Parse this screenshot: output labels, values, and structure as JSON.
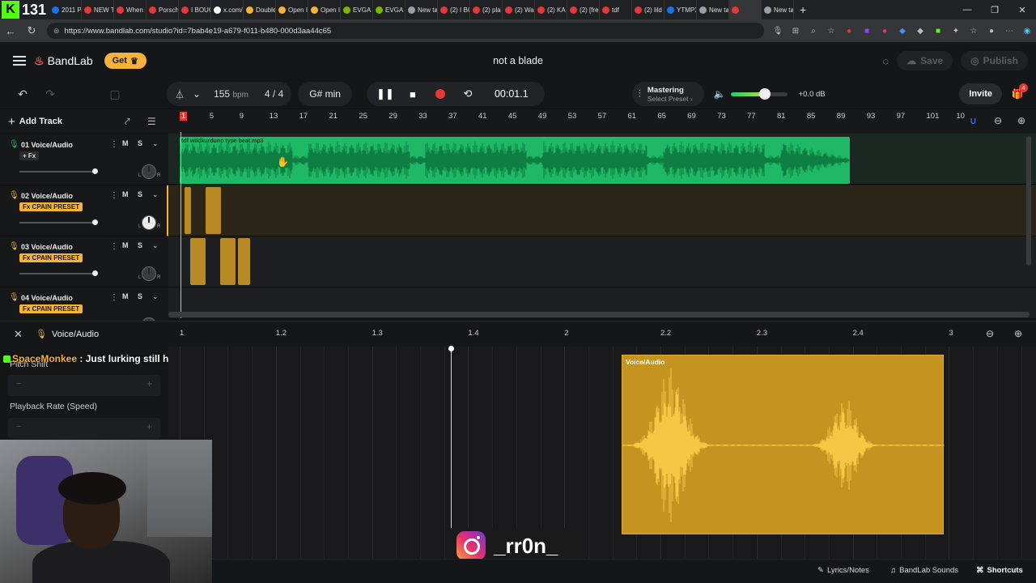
{
  "browser": {
    "kick_letter": "K",
    "tab_count": "131",
    "tabs": [
      {
        "label": "2011 P",
        "color": "#1a73e8"
      },
      {
        "label": "NEW T",
        "color": "#e53935"
      },
      {
        "label": "When",
        "color": "#e53935"
      },
      {
        "label": "Porsch",
        "color": "#e53935"
      },
      {
        "label": "I BOUG",
        "color": "#e53935"
      },
      {
        "label": "x.com/",
        "color": "#ffffff"
      },
      {
        "label": "Double",
        "color": "#f5b33a"
      },
      {
        "label": "Open I",
        "color": "#f5b33a"
      },
      {
        "label": "Open I",
        "color": "#f5b33a"
      },
      {
        "label": "EVGA C",
        "color": "#76b900"
      },
      {
        "label": "EVGA C",
        "color": "#76b900"
      },
      {
        "label": "New ta",
        "color": "#9aa0a6"
      },
      {
        "label": "(2) I BC",
        "color": "#e53935"
      },
      {
        "label": "(2) pla",
        "color": "#e53935"
      },
      {
        "label": "(2) Wa",
        "color": "#e53935"
      },
      {
        "label": "(2) KA",
        "color": "#e53935"
      },
      {
        "label": "(2) [fre",
        "color": "#e53935"
      },
      {
        "label": "tdf",
        "color": "#e53935"
      },
      {
        "label": "(2) lild",
        "color": "#e53935"
      },
      {
        "label": "YTMP3",
        "color": "#1a73e8"
      },
      {
        "label": "New ta",
        "color": "#9aa0a6"
      },
      {
        "label": "",
        "color": "#e53935"
      },
      {
        "label": "New ta",
        "color": "#9aa0a6"
      }
    ],
    "url": "https://www.bandlab.com/studio?id=7bab4e19-a679-f011-b480-000d3aa44c65"
  },
  "header": {
    "logo": "BandLab",
    "get_label": "Get",
    "title": "not a blade",
    "save_label": "Save",
    "publish_label": "Publish"
  },
  "toolbar": {
    "bpm_value": "155",
    "bpm_unit": "bpm",
    "time_sig": "4 / 4",
    "key": "G# min",
    "time": "00:01.1",
    "mastering_label": "Mastering",
    "mastering_sub": "Select Preset ›",
    "master_volume": 0.6,
    "db": "+0.0 dB",
    "invite_label": "Invite",
    "gift_badge": "4"
  },
  "tracks_panel": {
    "add_track_label": "Add Track",
    "tracks": [
      {
        "number_name": "01  Voice/Audio",
        "fx": "+ Fx",
        "fx_preset": false,
        "mic_color": "#1eb866",
        "m": "M",
        "s": "S"
      },
      {
        "number_name": "02  Voice/Audio",
        "fx": "Fx CPAIN PRESET",
        "fx_preset": true,
        "mic_color": "#f5b33a",
        "m": "M",
        "s": "S"
      },
      {
        "number_name": "03  Voice/Audio",
        "fx": "Fx CPAIN PRESET",
        "fx_preset": true,
        "mic_color": "#f5b33a",
        "m": "M",
        "s": "S"
      },
      {
        "number_name": "04  Voice/Audio",
        "fx": "Fx CPAIN PRESET",
        "fx_preset": true,
        "mic_color": "#f5b33a",
        "m": "M",
        "s": "S"
      }
    ],
    "pan_left": "L",
    "pan_right": "R"
  },
  "timeline": {
    "ruler": [
      "1",
      "5",
      "9",
      "13",
      "17",
      "21",
      "25",
      "29",
      "33",
      "37",
      "41",
      "45",
      "49",
      "53",
      "57",
      "61",
      "65",
      "69",
      "73",
      "77",
      "81",
      "85",
      "89",
      "93",
      "97",
      "101",
      "10"
    ],
    "clip_name": "tdf wildkurduno  type beat.mp3"
  },
  "editor": {
    "title": "Voice/Audio",
    "ruler": [
      "1",
      "1.2",
      "1.3",
      "1.4",
      "2",
      "2.2",
      "2.3",
      "2.4",
      "3"
    ],
    "region_label": "Voice/Audio",
    "pitch_label": "Pitch Shift",
    "rate_label": "Playback Rate (Speed)",
    "minus": "−",
    "plus": "+"
  },
  "chat": {
    "user": "SpaceMonkee",
    "message": " : Just lurking still hyped"
  },
  "overlay": {
    "instagram_handle": "_rr0n_"
  },
  "bottom_bar": {
    "lyrics_label": "Lyrics/Notes",
    "sounds_label": "BandLab Sounds",
    "shortcuts_label": "Shortcuts"
  }
}
